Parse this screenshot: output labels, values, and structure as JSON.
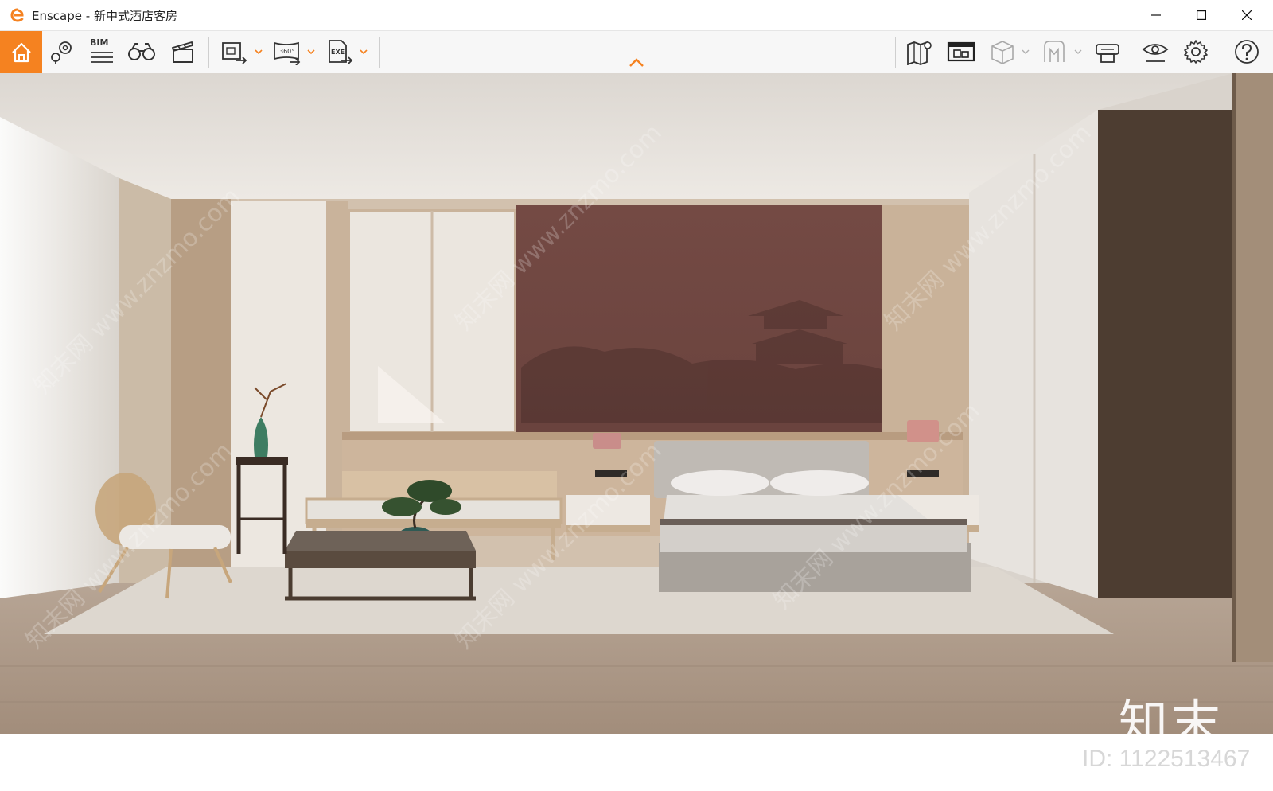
{
  "window": {
    "app_name": "Enscape",
    "separator": " - ",
    "project_name": "新中式酒店客房",
    "accent_color": "#f58220"
  },
  "toolbar": {
    "bim_label": "BIM",
    "pano_label": "360°",
    "exe_label": "EXE",
    "items": [
      {
        "name": "home-icon",
        "active": true
      },
      {
        "name": "navigation-pin-icon"
      },
      {
        "name": "bim-icon"
      },
      {
        "name": "binoculars-icon"
      },
      {
        "name": "clapperboard-icon"
      },
      {
        "name": "render-screenshot-icon"
      },
      {
        "name": "render-360-icon"
      },
      {
        "name": "export-exe-icon"
      },
      {
        "name": "map-pin-icon"
      },
      {
        "name": "asset-library-icon"
      },
      {
        "name": "section-box-icon"
      },
      {
        "name": "vr-headset-icon"
      },
      {
        "name": "live-link-icon"
      },
      {
        "name": "visual-settings-icon"
      },
      {
        "name": "settings-gear-icon"
      },
      {
        "name": "help-icon"
      }
    ]
  },
  "watermark": {
    "brand": "知末",
    "id_text": "ID: 1122513467",
    "diagonal_text": "知末网 www.znzmo.com"
  }
}
